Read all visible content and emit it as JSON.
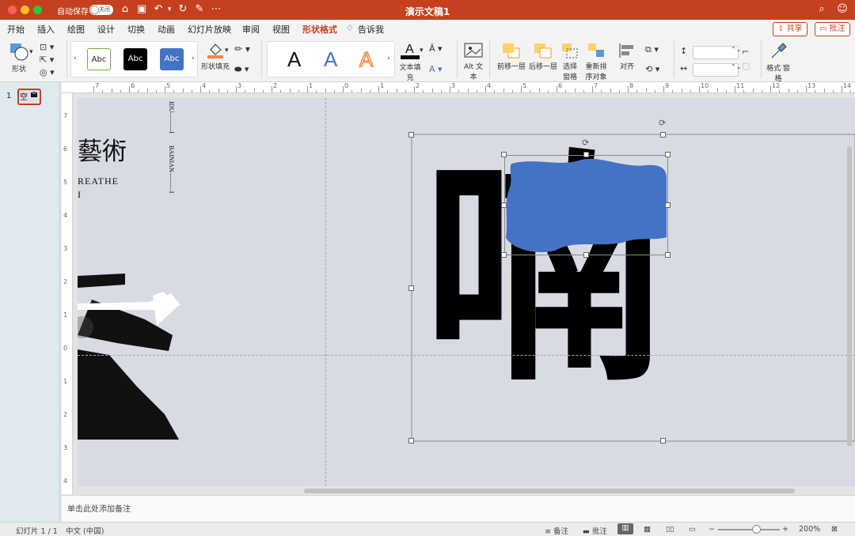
{
  "titlebar": {
    "autosave_label": "自动保存",
    "autosave_state": "关闭",
    "document_title": "演示文稿1"
  },
  "tabs": [
    {
      "label": "开始"
    },
    {
      "label": "插入"
    },
    {
      "label": "绘图"
    },
    {
      "label": "设计"
    },
    {
      "label": "切换"
    },
    {
      "label": "动画"
    },
    {
      "label": "幻灯片放映"
    },
    {
      "label": "审阅"
    },
    {
      "label": "视图"
    },
    {
      "label": "形状格式",
      "active": true
    },
    {
      "label": "告诉我"
    }
  ],
  "actions": {
    "share": "共享",
    "comments": "批注"
  },
  "ribbon": {
    "shapes_label": "形状",
    "shape_styles": [
      "Abc",
      "Abc",
      "Abc"
    ],
    "shape_fill_label": "形状填充",
    "wordart_letters": [
      "A",
      "A",
      "A"
    ],
    "text_fill_label": "文本填充",
    "alt_text_label": "Alt 文本",
    "bring_forward_label": "前移一层",
    "send_backward_label": "后移一层",
    "selection_pane_label": "选择 窗格",
    "reorder_objects_label": "重新排 序对象",
    "align_label": "对齐",
    "format_pane_label": "格式 窗格",
    "accent_color": "#c4401f"
  },
  "ruler": {
    "h_numbers": [
      "7",
      "6",
      "5",
      "4",
      "3",
      "2",
      "1",
      "0",
      "1",
      "2",
      "3",
      "4",
      "5",
      "6",
      "7",
      "8",
      "9",
      "10",
      "11",
      "12",
      "13",
      "14",
      "15"
    ],
    "v_numbers": [
      "7",
      "6",
      "5",
      "4",
      "3",
      "2",
      "1",
      "0",
      "1",
      "2",
      "3",
      "4"
    ]
  },
  "thumbnails": {
    "slide_number": "1"
  },
  "slide": {
    "left_heading": "藝術",
    "left_english_1": "REATHE",
    "left_english_2": "I",
    "vertical_text_1": "IDU———I",
    "vertical_text_2": "BAINIAN———I",
    "left_big_char": "空",
    "right_big_char": "喃",
    "shape_fill_color": "#4472c4"
  },
  "notes": {
    "placeholder": "单击此处添加备注"
  },
  "status": {
    "slide_counter": "幻灯片 1 / 1",
    "language": "中文 (中国)",
    "notes_label": "备注",
    "comments_label": "批注",
    "zoom": "200%"
  }
}
